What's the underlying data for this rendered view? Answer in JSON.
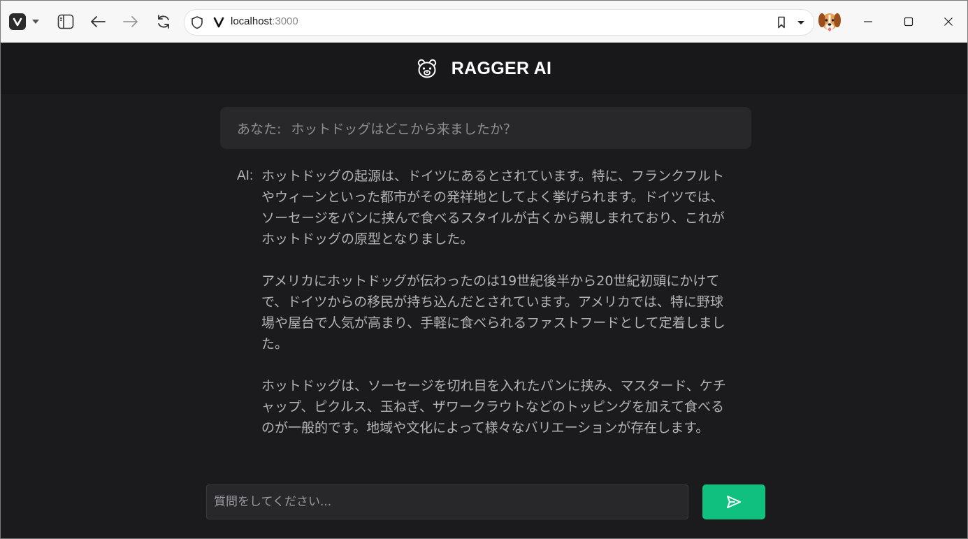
{
  "browser": {
    "url_host": "localhost",
    "url_port": ":3000",
    "icons": {
      "logo": "vivaldi-icon",
      "menu": "chevron-down-icon",
      "sidebar": "sidebar-panel-icon",
      "back": "arrow-left-icon",
      "forward": "arrow-right-icon",
      "reload": "reload-icon",
      "security": "shield-icon",
      "site": "vivaldi-v-icon",
      "bookmark": "bookmark-icon",
      "dropdown": "caret-down-icon",
      "avatar": "dog-avatar-icon",
      "minimize": "minimize-icon",
      "maximize": "maximize-icon",
      "close": "close-icon"
    }
  },
  "app": {
    "title": "RAGGER AI",
    "logo_icon": "bear-icon",
    "accent_color": "#10c07f",
    "background_color": "#1b1b1d"
  },
  "conversation": {
    "user": {
      "label": "あなた:",
      "text": "ホットドッグはどこから来ましたか？"
    },
    "ai": {
      "label": "AI:",
      "paragraphs": [
        "ホットドッグの起源は、ドイツにあるとされています。特に、フランクフルトやウィーンといった都市がその発祥地としてよく挙げられます。ドイツでは、ソーセージをパンに挟んで食べるスタイルが古くから親しまれており、これがホットドッグの原型となりました。",
        "アメリカにホットドッグが伝わったのは19世紀後半から20世紀初頭にかけてで、ドイツからの移民が持ち込んだとされています。アメリカでは、特に野球場や屋台で人気が高まり、手軽に食べられるファストフードとして定着しました。",
        "ホットドッグは、ソーセージを切れ目を入れたパンに挟み、マスタード、ケチャップ、ピクルス、玉ねぎ、ザワークラウトなどのトッピングを加えて食べるのが一般的です。地域や文化によって様々なバリエーションが存在します。"
      ]
    }
  },
  "composer": {
    "placeholder": "質問をしてください...",
    "value": "",
    "send_icon": "send-icon"
  }
}
